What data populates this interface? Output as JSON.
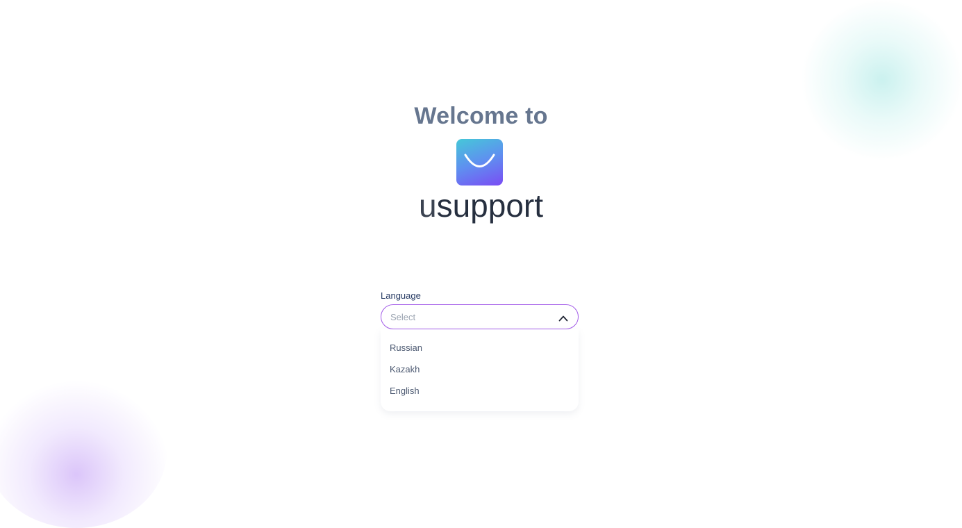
{
  "welcome": {
    "title": "Welcome to"
  },
  "logo": {
    "icon": "smile-icon",
    "wordmark_prefix": "u",
    "wordmark_rest": "support"
  },
  "language_field": {
    "label": "Language",
    "placeholder": "Select",
    "expanded": true,
    "options": [
      "Russian",
      "Kazakh",
      "English"
    ]
  },
  "colors": {
    "accent": "#a35ce8",
    "title": "#66768f",
    "logo_gradient_start": "#45c8d8",
    "logo_gradient_end": "#7a4cf4"
  }
}
